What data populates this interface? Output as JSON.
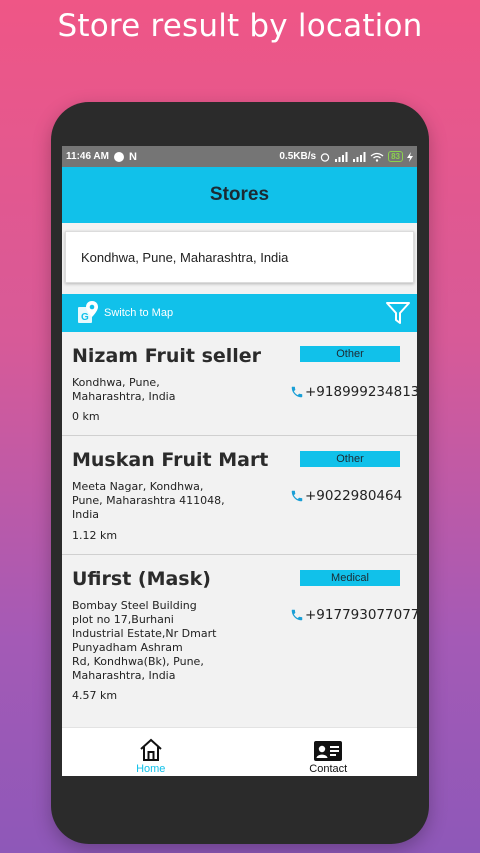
{
  "headline": "Store result by location",
  "status_bar": {
    "time": "11:46 AM",
    "speed": "0.5KB/s",
    "battery": "83"
  },
  "app_bar": {
    "title": "Stores"
  },
  "search": {
    "value": "Kondhwa, Pune, Maharashtra, India"
  },
  "toolbar": {
    "map_label": "Switch to Map"
  },
  "stores": [
    {
      "name": "Nizam Fruit seller",
      "category": "Other",
      "address_lines": [
        "Kondhwa, Pune,",
        "Maharashtra, India"
      ],
      "distance": "0 km",
      "phone": "+918999234813"
    },
    {
      "name": "Muskan Fruit Mart",
      "category": "Other",
      "address_lines": [
        "Meeta Nagar, Kondhwa,",
        "Pune, Maharashtra 411048,",
        "India"
      ],
      "distance": "1.12 km",
      "phone": "+9022980464"
    },
    {
      "name": "Ufirst (Mask)",
      "category": "Medical",
      "address_lines": [
        "Bombay Steel Building",
        "plot no 17,Burhani",
        "Industrial Estate,Nr Dmart",
        "Punyadham Ashram",
        "Rd, Kondhwa(Bk), Pune,",
        "Maharashtra, India"
      ],
      "distance": "4.57 km",
      "phone": "+917793077077"
    }
  ],
  "bottom_nav": {
    "home_label": "Home",
    "contact_label": "Contact"
  },
  "colors": {
    "accent": "#11c1ea",
    "phone_icon": "#1a9fd6"
  }
}
